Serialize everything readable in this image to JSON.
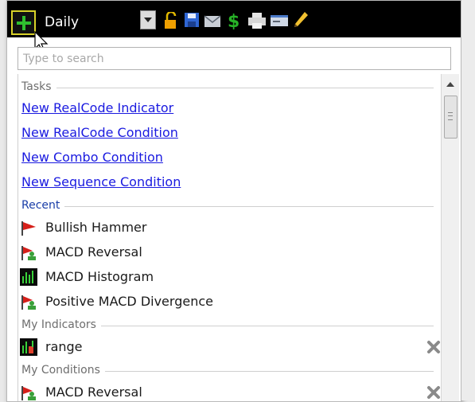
{
  "toolbar": {
    "period": "Daily",
    "icons": [
      "add-icon",
      "dropdown-arrow-icon",
      "unlock-icon",
      "save-icon",
      "email-icon",
      "dollar-icon",
      "print-icon",
      "card-icon",
      "pencil-icon"
    ]
  },
  "search": {
    "placeholder": "Type to search"
  },
  "sections": {
    "tasks": "Tasks",
    "recent": "Recent",
    "my_indicators": "My Indicators",
    "my_conditions": "My Conditions"
  },
  "tasks": [
    "New RealCode Indicator",
    "New RealCode Condition",
    "New Combo Condition",
    "New Sequence Condition"
  ],
  "recent": [
    {
      "label": "Bullish Hammer",
      "icon": "red-flag-icon"
    },
    {
      "label": "MACD Reversal",
      "icon": "flag-person-icon"
    },
    {
      "label": "MACD Histogram",
      "icon": "histogram-icon"
    },
    {
      "label": "Positive MACD Divergence",
      "icon": "flag-person-icon"
    }
  ],
  "my_indicators": [
    {
      "label": "range",
      "icon": "indicator-chart-icon"
    }
  ],
  "my_conditions": [
    {
      "label": "MACD Reversal",
      "icon": "flag-person-icon"
    }
  ],
  "colors": {
    "toolbar_bg": "#000000",
    "link": "#1a1ae0",
    "accent_yellow": "#d8d229"
  }
}
